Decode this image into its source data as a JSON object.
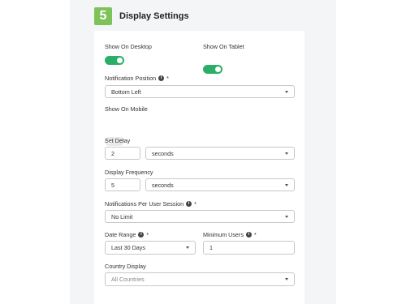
{
  "step": {
    "number": "5",
    "title": "Display Settings"
  },
  "show_on_desktop": {
    "label": "Show On Desktop",
    "enabled": true
  },
  "show_on_tablet": {
    "label": "Show On Tablet",
    "enabled": true
  },
  "show_on_mobile": {
    "label": "Show On Mobile",
    "enabled": false
  },
  "notification_position": {
    "label": "Notification Position",
    "required": "*",
    "value": "Bottom Left"
  },
  "set_delay": {
    "label": "Set Delay",
    "value": "2",
    "unit": "seconds"
  },
  "display_frequency": {
    "label": "Display Frequency",
    "value": "5",
    "unit": "seconds"
  },
  "notifications_per_session": {
    "label": "Notifications Per User Session",
    "required": "*",
    "value": "No Limit"
  },
  "date_range": {
    "label": "Date Range",
    "required": "*",
    "value": "Last 30 Days"
  },
  "minimum_users": {
    "label": "Minimum Users",
    "required": "*",
    "value": "1"
  },
  "country_display": {
    "label": "Country Display",
    "placeholder": "All Countries"
  },
  "colors": {
    "accent": "#7ec25a",
    "toggle_on": "#2bae66"
  }
}
